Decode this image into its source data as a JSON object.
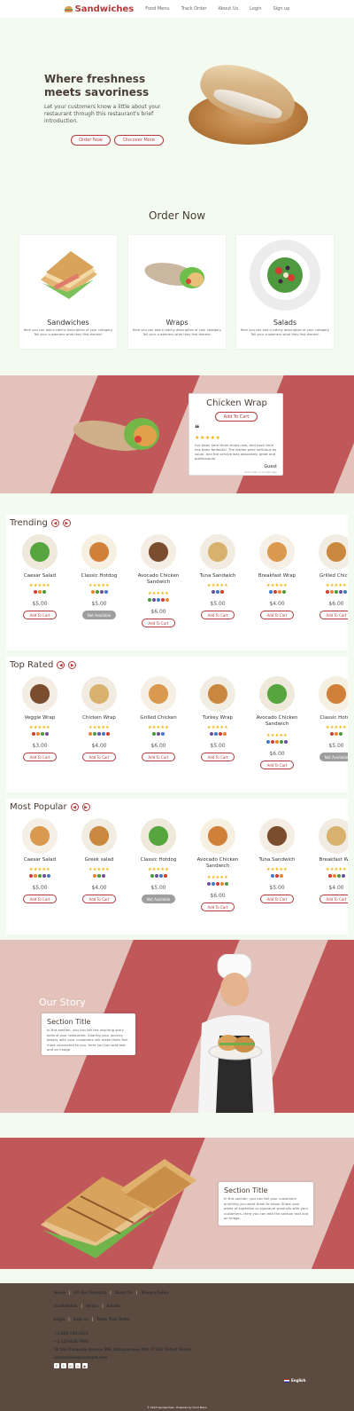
{
  "nav": {
    "brand": "Sandwiches",
    "links": [
      "Food Menu",
      "Track Order",
      "About Us",
      "Login",
      "Sign up"
    ]
  },
  "hero": {
    "title": "Where freshness meets savoriness",
    "subtitle": "Let your customers know a little about your restaurant through this restaurant's brief introduction.",
    "order_now": "Order Now",
    "discover_more": "Discover More"
  },
  "order": {
    "title": "Order Now",
    "categories": [
      {
        "name": "Sandwiches",
        "desc": "Here you can add a catchy description of your category. Tell your customers what they find therein!"
      },
      {
        "name": "Wraps",
        "desc": "Here you can add a catchy description of your category. Tell your customers what they find therein!"
      },
      {
        "name": "Salads",
        "desc": "Here you can add a catchy description of your category. Tell your customers what they find therein!"
      }
    ]
  },
  "featured": {
    "name": "Chicken Wrap",
    "add_label": "Add To Cart",
    "quote": "❝",
    "stars": "★★★★★",
    "review": "I've been here three times now, and each time has been fantastic! The dishes were delicious as usual, and the service was absolutely great and professional.",
    "author": "Guest",
    "time": "more than 1 months ago"
  },
  "sections": [
    {
      "title": "Trending",
      "items": [
        {
          "name": "Caesar Salad",
          "price": "$5.00",
          "btn": "Add To Cart",
          "available": true
        },
        {
          "name": "Classic Hotdog",
          "price": "$5.00",
          "btn": "Not Available",
          "available": false
        },
        {
          "name": "Avocado Chicken Sandwich",
          "price": "$6.00",
          "btn": "Add To Cart",
          "available": true
        },
        {
          "name": "Tuna Sandwich",
          "price": "$5.00",
          "btn": "Add To Cart",
          "available": true
        },
        {
          "name": "Breakfast Wrap",
          "price": "$4.00",
          "btn": "Add To Cart",
          "available": true
        },
        {
          "name": "Grilled Chicke",
          "price": "$6.00",
          "btn": "Add To Cart",
          "available": true
        }
      ]
    },
    {
      "title": "Top Rated",
      "items": [
        {
          "name": "Veggie Wrap",
          "price": "$3.00",
          "btn": "Add To Cart",
          "available": true
        },
        {
          "name": "Chicken Wrap",
          "price": "$4.00",
          "btn": "Add To Cart",
          "available": true
        },
        {
          "name": "Grilled Chicken",
          "price": "$6.00",
          "btn": "Add To Cart",
          "available": true
        },
        {
          "name": "Turkey Wrap",
          "price": "$5.00",
          "btn": "Add To Cart",
          "available": true
        },
        {
          "name": "Avocado Chicken Sandwich",
          "price": "$6.00",
          "btn": "Add To Cart",
          "available": true
        },
        {
          "name": "Classic Hotdo",
          "price": "$5.00",
          "btn": "Not Available",
          "available": false
        }
      ]
    },
    {
      "title": "Most Popular",
      "items": [
        {
          "name": "Caesar Salad",
          "price": "$5.00",
          "btn": "Add To Cart",
          "available": true
        },
        {
          "name": "Greek salad",
          "price": "$4.00",
          "btn": "Add To Cart",
          "available": true
        },
        {
          "name": "Classic Hotdog",
          "price": "$5.00",
          "btn": "Not Available",
          "available": false
        },
        {
          "name": "Avocado Chicken Sandwich",
          "price": "$6.00",
          "btn": "Add To Cart",
          "available": true
        },
        {
          "name": "Tuna Sandwich",
          "price": "$5.00",
          "btn": "Add To Cart",
          "available": true
        },
        {
          "name": "Breakfast Wra",
          "price": "$4.00",
          "btn": "Add To Cart",
          "available": true
        }
      ]
    }
  ],
  "story": {
    "heading": "Our Story",
    "card_title": "Section Title",
    "card_text": "In this section, you can tell the inspiring story behind your restaurant. Sharing your journey deeply with your customers will make them feel more connected to you. Here you can add text and an image."
  },
  "section2": {
    "card_title": "Section Title",
    "card_text": "In this section, you can tell your customers anything you want them to know. Share your areas of expertise or signature products with your customers. Here you can edit the section text and an image."
  },
  "footer": {
    "row1": [
      "Home",
      "All Our Products",
      "About Us",
      "Privacy Policy"
    ],
    "row2": [
      "Sandwiches",
      "Wraps",
      "Salads"
    ],
    "row3": [
      "Login",
      "Sign up",
      "Track Your Order"
    ],
    "phone1": "+1-800-765-4321",
    "phone2": "+1-123-456-7890",
    "address": "30 San Pasquale Avenue NW, Albuquerque, NM, 87104 United States",
    "email": "sandwiches@example.com",
    "language": "English",
    "copyright": "© 2023 Sandwiches - Powered by Food Menu"
  },
  "colors": {
    "accent": "#b23a3a",
    "background": "#f3fbf0",
    "stripe": "#c0585a",
    "footer": "#5b4a40"
  }
}
